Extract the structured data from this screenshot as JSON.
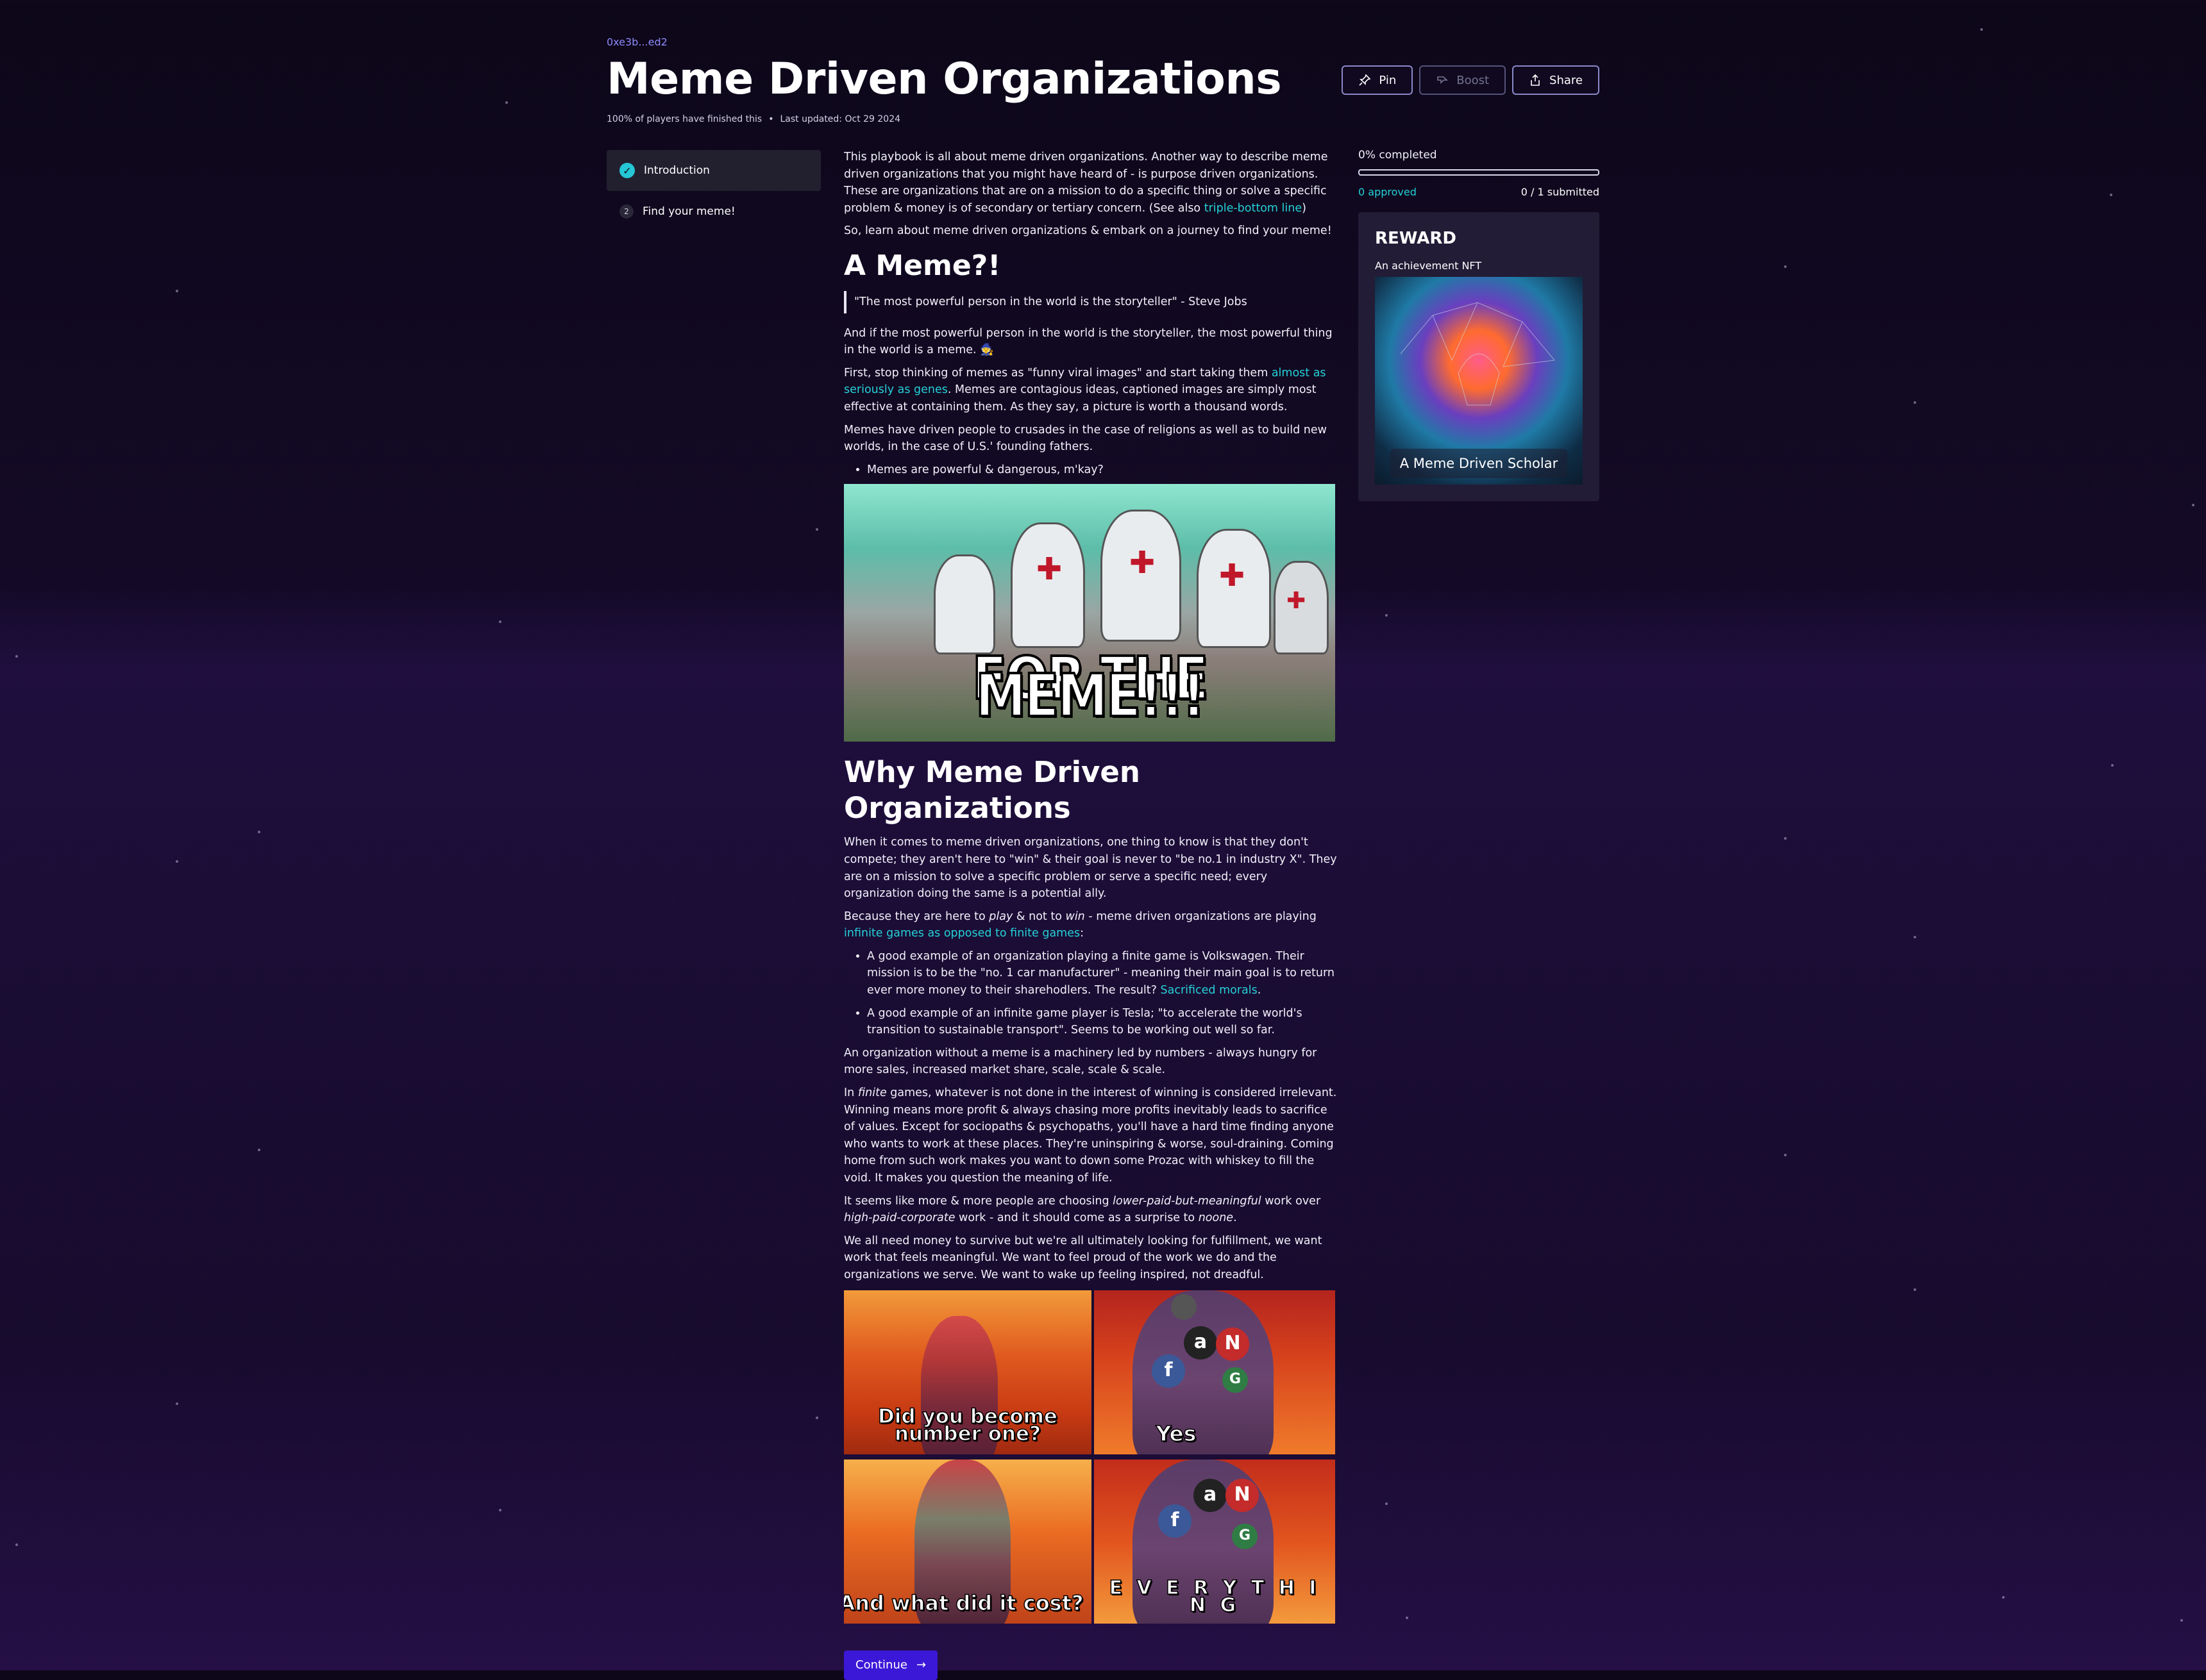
{
  "header": {
    "address": "0xe3b...ed2",
    "title": "Meme Driven Organizations",
    "finished": "100% of players have finished this",
    "updated": "Last updated: Oct 29 2024"
  },
  "actions": {
    "pin": "Pin",
    "boost": "Boost",
    "share": "Share"
  },
  "nav": {
    "items": [
      {
        "label": "Introduction",
        "state": "completed"
      },
      {
        "label": "Find your meme!",
        "number": "2"
      }
    ]
  },
  "content": {
    "p1_a": "This playbook is all about meme driven organizations. Another way to describe meme driven organizations that you might have heard of - is purpose driven organizations. These are organizations that are on a mission to do a specific thing or solve a specific problem & money is of secondary or tertiary concern. (See also ",
    "p1_link": "triple-bottom line",
    "p1_b": ")",
    "p2": "So, learn about meme driven organizations & embark on a journey to find your meme!",
    "h_meme": "A Meme?!",
    "quote": "\"The most powerful person in the world is the storyteller\" - Steve Jobs",
    "p3": "And if the most powerful person in the world is the storyteller, the most powerful thing in the world is a meme. 🧙",
    "p4_a": "First, stop thinking of memes as \"funny viral images\" and start taking them ",
    "p4_link": "almost as seriously as genes",
    "p4_b": ". Memes are contagious ideas, captioned images are simply most effective at containing them. As they say, a picture is worth a thousand words.",
    "p5": "Memes have driven people to crusades in the case of religions as well as to build new worlds, in the case of U.S.' founding fathers.",
    "li1": "Memes are powerful & dangerous, m'kay?",
    "img1_caption": "FOR THE MEME!!!",
    "h_why": "Why Meme Driven Organizations",
    "p6": "When it comes to meme driven organizations, one thing to know is that they don't compete; they aren't here to \"win\" & their goal is never to \"be no.1 in industry X\". They are on a mission to solve a specific problem or serve a specific need; every organization doing the same is a potential ally.",
    "p7_a": "Because they are here to ",
    "p7_play": "play",
    "p7_b": " & not to ",
    "p7_win": "win",
    "p7_c": " - meme driven organizations are playing ",
    "p7_link": "infinite games as opposed to finite games",
    "p7_d": ":",
    "li2_a": "A good example of an organization playing a finite game is Volkswagen. Their mission is to be the \"no. 1 car manufacturer\" - meaning their main goal is to return ever more money to their sharehodlers. The result? ",
    "li2_link": "Sacrificed morals",
    "li2_b": ".",
    "li3": "A good example of an infinite game player is Tesla; \"to accelerate the world's transition to sustainable transport\". Seems to be working out well so far.",
    "p8": "An organization without a meme is a machinery led by numbers - always hungry for more sales, increased market share, scale, scale & scale.",
    "p9_a": "In ",
    "p9_finite": "finite",
    "p9_b": " games, whatever is not done in the interest of winning is considered irrelevant. Winning means more profit & always chasing more profits inevitably leads to sacrifice of values. Except for sociopaths & psychopaths, you'll have a hard time finding anyone who wants to work at these places. They're uninspiring & worse, soul-draining. Coming home from such work makes you want to down some Prozac with whiskey to fill the void. It makes you question the meaning of life.",
    "p10_a": "It seems like more & more people are choosing ",
    "p10_em1": "lower-paid-but-meaningful",
    "p10_b": " work over ",
    "p10_em2": "high-paid-corporate",
    "p10_c": " work - and it should come as a surprise to ",
    "p10_em3": "noone",
    "p10_d": ".",
    "p11": "We all need money to survive but we're all ultimately looking for fulfillment, we want work that feels meaningful. We want to feel proud of the work we do and the organizations we serve. We want to wake up feeling inspired, not dreadful.",
    "meme2_tl": "Did you become number one?",
    "meme2_tr": "Yes",
    "meme2_bl": "And what did it cost?",
    "meme2_br": "E V E R Y T H I N G",
    "continue": "Continue"
  },
  "progress": {
    "completed_label": "0% completed",
    "completed_fraction": 0,
    "approved": "0 approved",
    "submitted": "0 / 1 submitted"
  },
  "reward": {
    "title": "REWARD",
    "subtitle": "An achievement NFT",
    "nft_name": "A Meme Driven Scholar"
  },
  "colors": {
    "accent": "#25d1d9",
    "primary_button": "#3b18d8",
    "link": "#8d8afc"
  }
}
